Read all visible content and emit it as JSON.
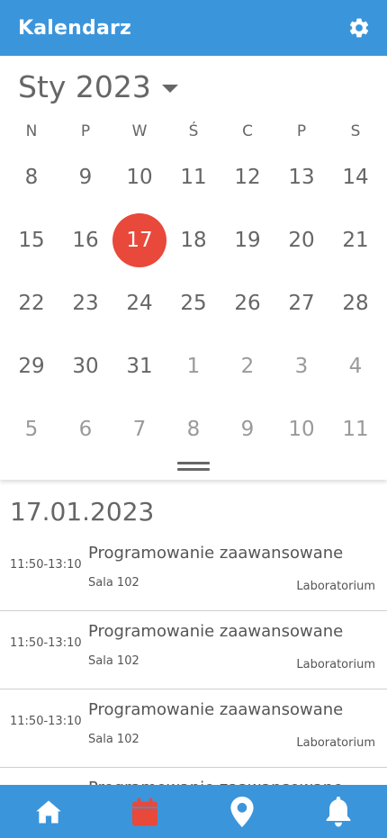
{
  "appbar": {
    "title": "Kalendarz"
  },
  "calendar": {
    "month_label": "Sty 2023",
    "weekdays": [
      "N",
      "P",
      "W",
      "Ś",
      "C",
      "P",
      "S"
    ],
    "weeks": [
      [
        {
          "d": "8",
          "o": false
        },
        {
          "d": "9",
          "o": false
        },
        {
          "d": "10",
          "o": false
        },
        {
          "d": "11",
          "o": false
        },
        {
          "d": "12",
          "o": false
        },
        {
          "d": "13",
          "o": false
        },
        {
          "d": "14",
          "o": false
        }
      ],
      [
        {
          "d": "15",
          "o": false
        },
        {
          "d": "16",
          "o": false
        },
        {
          "d": "17",
          "o": false,
          "sel": true
        },
        {
          "d": "18",
          "o": false
        },
        {
          "d": "19",
          "o": false
        },
        {
          "d": "20",
          "o": false
        },
        {
          "d": "21",
          "o": false
        }
      ],
      [
        {
          "d": "22",
          "o": false
        },
        {
          "d": "23",
          "o": false
        },
        {
          "d": "24",
          "o": false
        },
        {
          "d": "25",
          "o": false
        },
        {
          "d": "26",
          "o": false
        },
        {
          "d": "27",
          "o": false
        },
        {
          "d": "28",
          "o": false
        }
      ],
      [
        {
          "d": "29",
          "o": false
        },
        {
          "d": "30",
          "o": false
        },
        {
          "d": "31",
          "o": false
        },
        {
          "d": "1",
          "o": true
        },
        {
          "d": "2",
          "o": true
        },
        {
          "d": "3",
          "o": true
        },
        {
          "d": "4",
          "o": true
        }
      ],
      [
        {
          "d": "5",
          "o": true
        },
        {
          "d": "6",
          "o": true
        },
        {
          "d": "7",
          "o": true
        },
        {
          "d": "8",
          "o": true
        },
        {
          "d": "9",
          "o": true
        },
        {
          "d": "10",
          "o": true
        },
        {
          "d": "11",
          "o": true
        }
      ]
    ]
  },
  "agenda": {
    "date": "17.01.2023",
    "events": [
      {
        "time": "11:50-13:10",
        "title": "Programowanie zaawansowane",
        "room": "Sala 102",
        "type": "Laboratorium"
      },
      {
        "time": "11:50-13:10",
        "title": "Programowanie zaawansowane",
        "room": "Sala 102",
        "type": "Laboratorium"
      },
      {
        "time": "11:50-13:10",
        "title": "Programowanie zaawansowane",
        "room": "Sala 102",
        "type": "Laboratorium"
      },
      {
        "time": "",
        "title": "Programowanie zaawansowane",
        "room": "",
        "type": ""
      }
    ]
  },
  "colors": {
    "accent": "#3b95db",
    "selected": "#e8493a",
    "active_nav": "#e8493a"
  },
  "bottom_nav": {
    "items": [
      {
        "icon": "home-icon",
        "active": false
      },
      {
        "icon": "calendar-icon",
        "active": true
      },
      {
        "icon": "map-pin-icon",
        "active": false
      },
      {
        "icon": "bell-icon",
        "active": false
      }
    ]
  }
}
